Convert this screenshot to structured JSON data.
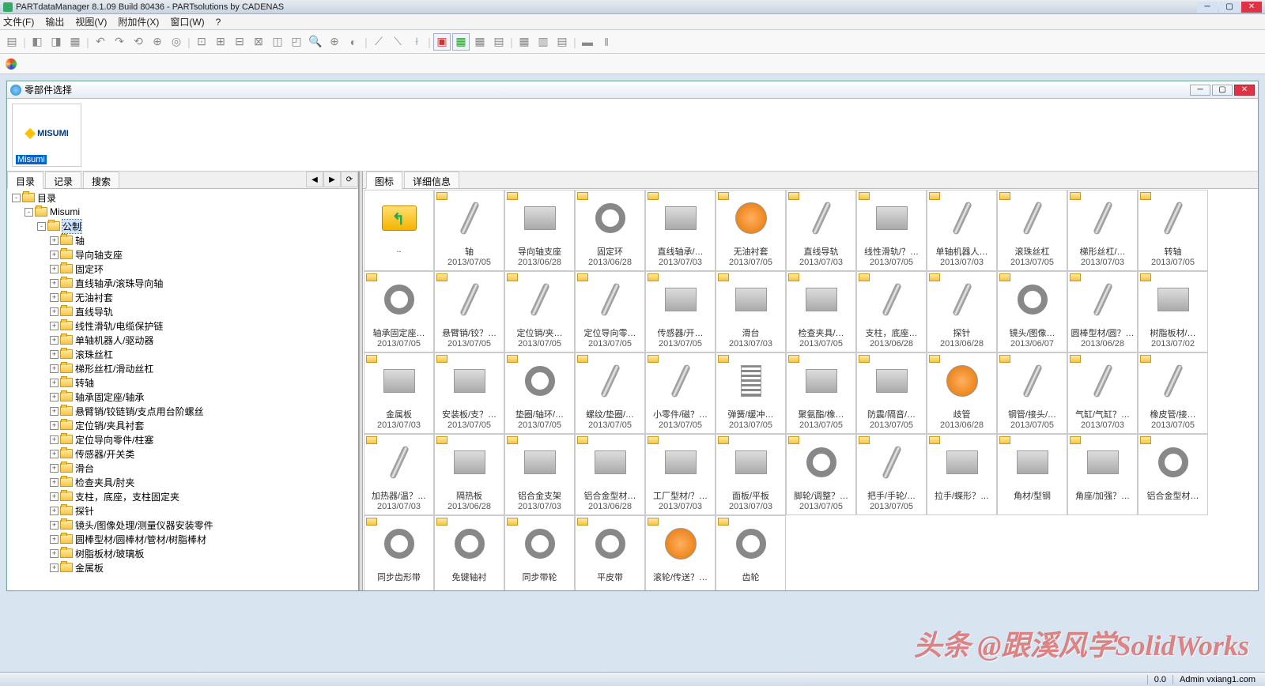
{
  "window": {
    "title": "PARTdataManager 8.1.09 Build 80436 - PARTsolutions by CADENAS"
  },
  "menu": [
    "文件(F)",
    "输出",
    "视图(V)",
    "附加件(X)",
    "窗口(W)",
    "?"
  ],
  "toolbar2_icon": "color-wheel",
  "subwindow": {
    "title": "零部件选择",
    "logo_text": "MISUMI",
    "logo_label": "Misumi"
  },
  "left_tabs": [
    "目录",
    "记录",
    "搜索"
  ],
  "right_tabs": [
    "图标",
    "详细信息"
  ],
  "tree": [
    {
      "depth": 0,
      "exp": "-",
      "label": "目录"
    },
    {
      "depth": 1,
      "exp": "-",
      "label": "Misumi"
    },
    {
      "depth": 2,
      "exp": "-",
      "label": "公制",
      "selected": true
    },
    {
      "depth": 3,
      "exp": "+",
      "label": "轴"
    },
    {
      "depth": 3,
      "exp": "+",
      "label": "导向轴支座"
    },
    {
      "depth": 3,
      "exp": "+",
      "label": "固定环"
    },
    {
      "depth": 3,
      "exp": "+",
      "label": "直线轴承/滚珠导向轴"
    },
    {
      "depth": 3,
      "exp": "+",
      "label": "无油衬套"
    },
    {
      "depth": 3,
      "exp": "+",
      "label": "直线导轨"
    },
    {
      "depth": 3,
      "exp": "+",
      "label": "线性滑轨/电缆保护链"
    },
    {
      "depth": 3,
      "exp": "+",
      "label": "单轴机器人/驱动器"
    },
    {
      "depth": 3,
      "exp": "+",
      "label": "滚珠丝杠"
    },
    {
      "depth": 3,
      "exp": "+",
      "label": "梯形丝杠/滑动丝杠"
    },
    {
      "depth": 3,
      "exp": "+",
      "label": "转轴"
    },
    {
      "depth": 3,
      "exp": "+",
      "label": "轴承固定座/轴承"
    },
    {
      "depth": 3,
      "exp": "+",
      "label": "悬臂销/铰链销/支点用台阶螺丝"
    },
    {
      "depth": 3,
      "exp": "+",
      "label": "定位销/夹具衬套"
    },
    {
      "depth": 3,
      "exp": "+",
      "label": "定位导向零件/柱塞"
    },
    {
      "depth": 3,
      "exp": "+",
      "label": "传感器/开关类"
    },
    {
      "depth": 3,
      "exp": "+",
      "label": "滑台"
    },
    {
      "depth": 3,
      "exp": "+",
      "label": "检查夹具/肘夹"
    },
    {
      "depth": 3,
      "exp": "+",
      "label": "支柱，底座，支柱固定夹"
    },
    {
      "depth": 3,
      "exp": "+",
      "label": "探针"
    },
    {
      "depth": 3,
      "exp": "+",
      "label": "镜头/图像处理/测量仪器安装零件"
    },
    {
      "depth": 3,
      "exp": "+",
      "label": "圆棒型材/圆棒材/管材/树脂棒材"
    },
    {
      "depth": 3,
      "exp": "+",
      "label": "树脂板材/玻璃板"
    },
    {
      "depth": 3,
      "exp": "+",
      "label": "金属板"
    }
  ],
  "grid": [
    {
      "name": "..",
      "date": "",
      "up": true
    },
    {
      "name": "轴",
      "date": "2013/07/05",
      "ph": "cyl"
    },
    {
      "name": "导向轴支座",
      "date": "2013/06/28",
      "ph": "box"
    },
    {
      "name": "固定环",
      "date": "2013/06/28",
      "ph": "ring"
    },
    {
      "name": "直线轴承/…",
      "date": "2013/07/03",
      "ph": "box"
    },
    {
      "name": "无油衬套",
      "date": "2013/07/05",
      "ph": "orange"
    },
    {
      "name": "直线导轨",
      "date": "2013/07/03",
      "ph": "cyl"
    },
    {
      "name": "线性滑轨/？…",
      "date": "2013/07/05",
      "ph": "box"
    },
    {
      "name": "单轴机器人…",
      "date": "2013/07/03",
      "ph": "cyl"
    },
    {
      "name": "滚珠丝杠",
      "date": "2013/07/05",
      "ph": "cyl"
    },
    {
      "name": "梯形丝杠/…",
      "date": "2013/07/03",
      "ph": "cyl"
    },
    {
      "name": "转轴",
      "date": "2013/07/05",
      "ph": "cyl"
    },
    {
      "name": "轴承固定座…",
      "date": "2013/07/05",
      "ph": "ring"
    },
    {
      "name": "悬臂销/铰？…",
      "date": "2013/07/05",
      "ph": "cyl"
    },
    {
      "name": "定位销/夹…",
      "date": "2013/07/05",
      "ph": "cyl"
    },
    {
      "name": "定位导向零…",
      "date": "2013/07/05",
      "ph": "cyl"
    },
    {
      "name": "传感器/开…",
      "date": "2013/07/05",
      "ph": "box"
    },
    {
      "name": "滑台",
      "date": "2013/07/03",
      "ph": "box"
    },
    {
      "name": "检查夹具/…",
      "date": "2013/07/05",
      "ph": "box"
    },
    {
      "name": "支柱，底座…",
      "date": "2013/06/28",
      "ph": "cyl"
    },
    {
      "name": "探针",
      "date": "2013/06/28",
      "ph": "cyl"
    },
    {
      "name": "镜头/图像…",
      "date": "2013/06/07",
      "ph": "ring"
    },
    {
      "name": "圆棒型材/圆？…",
      "date": "2013/06/28",
      "ph": "cyl"
    },
    {
      "name": "树脂板材/…",
      "date": "2013/07/02",
      "ph": "box"
    },
    {
      "name": "金属板",
      "date": "2013/07/03",
      "ph": "box"
    },
    {
      "name": "安装板/支？…",
      "date": "2013/07/05",
      "ph": "box"
    },
    {
      "name": "垫圈/轴环/…",
      "date": "2013/07/05",
      "ph": "ring"
    },
    {
      "name": "螺纹/垫圈/…",
      "date": "2013/07/05",
      "ph": "cyl"
    },
    {
      "name": "小零件/磁？…",
      "date": "2013/07/05",
      "ph": "cyl"
    },
    {
      "name": "弹簧/缓冲…",
      "date": "2013/07/05",
      "ph": "spr"
    },
    {
      "name": "聚氨酯/橡…",
      "date": "2013/07/05",
      "ph": "box"
    },
    {
      "name": "防震/隔音/…",
      "date": "2013/07/05",
      "ph": "box"
    },
    {
      "name": "歧管",
      "date": "2013/06/28",
      "ph": "orange"
    },
    {
      "name": "钢管/接头/…",
      "date": "2013/07/05",
      "ph": "cyl"
    },
    {
      "name": "气缸/气缸？…",
      "date": "2013/07/03",
      "ph": "cyl"
    },
    {
      "name": "橡皮管/接…",
      "date": "2013/07/05",
      "ph": "cyl"
    },
    {
      "name": "加热器/温？…",
      "date": "2013/07/03",
      "ph": "cyl"
    },
    {
      "name": "隔热板",
      "date": "2013/06/28",
      "ph": "box"
    },
    {
      "name": "铝合金支架",
      "date": "2013/07/03",
      "ph": "box"
    },
    {
      "name": "铝合金型材…",
      "date": "2013/06/28",
      "ph": "box"
    },
    {
      "name": "工厂型材/？…",
      "date": "2013/07/03",
      "ph": "box"
    },
    {
      "name": "面板/平板",
      "date": "2013/07/03",
      "ph": "box"
    },
    {
      "name": "脚轮/调整？…",
      "date": "2013/07/05",
      "ph": "ring"
    },
    {
      "name": "把手/手轮/…",
      "date": "2013/07/05",
      "ph": "cyl"
    },
    {
      "name": "拉手/蝶形？…",
      "date": "",
      "ph": "box"
    },
    {
      "name": "角材/型钢",
      "date": "",
      "ph": "box"
    },
    {
      "name": "角座/加强？…",
      "date": "",
      "ph": "box"
    },
    {
      "name": "铝合金型材…",
      "date": "",
      "ph": "ring"
    },
    {
      "name": "同步齿形带",
      "date": "",
      "ph": "ring"
    },
    {
      "name": "免键轴衬",
      "date": "",
      "ph": "ring"
    },
    {
      "name": "同步带轮",
      "date": "",
      "ph": "ring"
    },
    {
      "name": "平皮带",
      "date": "",
      "ph": "ring"
    },
    {
      "name": "滚轮/传送？…",
      "date": "",
      "ph": "orange"
    },
    {
      "name": "齿轮",
      "date": "",
      "ph": "ring"
    }
  ],
  "status": {
    "left": "",
    "val": "0.0",
    "url": "Admin vxiang1.com"
  },
  "watermark": "头条 @跟溪风学SolidWorks"
}
